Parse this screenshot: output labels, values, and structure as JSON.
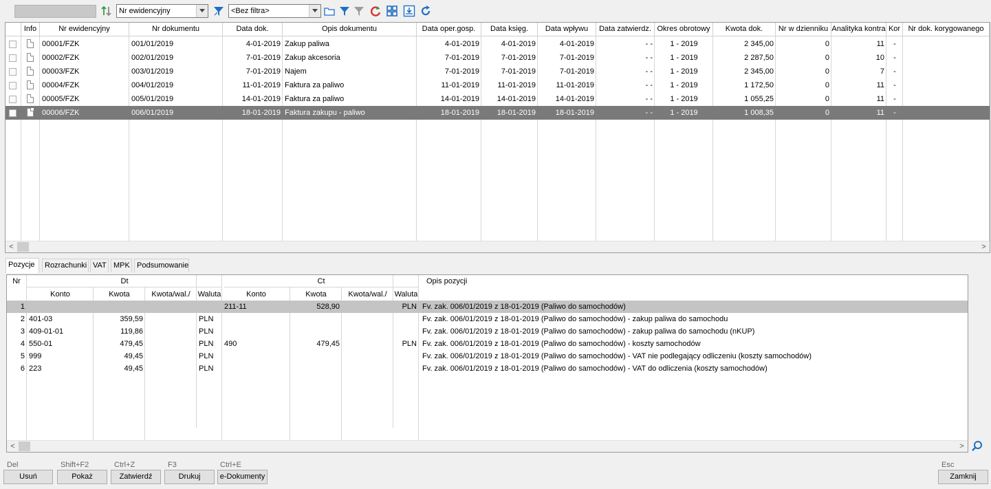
{
  "toolbar": {
    "sort_field": "Nr ewidencyjny",
    "filter_value": "<Bez filtra>",
    "icons": [
      "sort-arrows-icon",
      "filter-clear-icon",
      "folder-icon",
      "filter-icon",
      "filter-off-icon",
      "refresh-icon",
      "grid-icon",
      "export-icon",
      "reload-icon"
    ]
  },
  "grid": {
    "columns": [
      "Info",
      "Nr ewidencyjny",
      "Nr dokumentu",
      "Data dok.",
      "Opis dokumentu",
      "Data oper.gosp.",
      "Data księg.",
      "Data wpływu",
      "Data zatwierdz.",
      "Okres obrotowy",
      "Kwota dok.",
      "Nr w dzienniku",
      "Analityka kontra",
      "Kor",
      "Nr dok. korygowanego"
    ],
    "rows": [
      {
        "nr_ew": "00001/FZK",
        "nr_dok": "001/01/2019",
        "data_dok": "4-01-2019",
        "opis": "Zakup paliwa",
        "data_oper": "4-01-2019",
        "data_ksieg": "4-01-2019",
        "data_wpl": "4-01-2019",
        "data_zatw": "- -",
        "okres": "1 - 2019",
        "kwota": "2 345,00",
        "nr_dz": "0",
        "analityka": "11",
        "kor": "-"
      },
      {
        "nr_ew": "00002/FZK",
        "nr_dok": "002/01/2019",
        "data_dok": "7-01-2019",
        "opis": "Zakup akcesoria",
        "data_oper": "7-01-2019",
        "data_ksieg": "7-01-2019",
        "data_wpl": "7-01-2019",
        "data_zatw": "- -",
        "okres": "1 - 2019",
        "kwota": "2 287,50",
        "nr_dz": "0",
        "analityka": "10",
        "kor": "-"
      },
      {
        "nr_ew": "00003/FZK",
        "nr_dok": "003/01/2019",
        "data_dok": "7-01-2019",
        "opis": "Najem",
        "data_oper": "7-01-2019",
        "data_ksieg": "7-01-2019",
        "data_wpl": "7-01-2019",
        "data_zatw": "- -",
        "okres": "1 - 2019",
        "kwota": "2 345,00",
        "nr_dz": "0",
        "analityka": "7",
        "kor": "-"
      },
      {
        "nr_ew": "00004/FZK",
        "nr_dok": "004/01/2019",
        "data_dok": "11-01-2019",
        "opis": "Faktura za paliwo",
        "data_oper": "11-01-2019",
        "data_ksieg": "11-01-2019",
        "data_wpl": "11-01-2019",
        "data_zatw": "- -",
        "okres": "1 - 2019",
        "kwota": "1 172,50",
        "nr_dz": "0",
        "analityka": "11",
        "kor": "-"
      },
      {
        "nr_ew": "00005/FZK",
        "nr_dok": "005/01/2019",
        "data_dok": "14-01-2019",
        "opis": "Faktura za paliwo",
        "data_oper": "14-01-2019",
        "data_ksieg": "14-01-2019",
        "data_wpl": "14-01-2019",
        "data_zatw": "- -",
        "okres": "1 - 2019",
        "kwota": "1 055,25",
        "nr_dz": "0",
        "analityka": "11",
        "kor": "-"
      },
      {
        "nr_ew": "00006/FZK",
        "nr_dok": "006/01/2019",
        "data_dok": "18-01-2019",
        "opis": "Faktura zakupu - paliwo",
        "data_oper": "18-01-2019",
        "data_ksieg": "18-01-2019",
        "data_wpl": "18-01-2019",
        "data_zatw": "- -",
        "okres": "1 - 2019",
        "kwota": "1 008,35",
        "nr_dz": "0",
        "analityka": "11",
        "kor": "-"
      }
    ],
    "selected_row": 6
  },
  "tabs": [
    "Pozycje",
    "Rozrachunki",
    "VAT",
    "MPK",
    "Podsumowanie"
  ],
  "active_tab": "Pozycje",
  "positions": {
    "headers": {
      "nr": "Nr",
      "dt": "Dt",
      "ct": "Ct",
      "opis": "Opis pozycji",
      "konto": "Konto",
      "kwota": "Kwota",
      "kwota_wal": "Kwota/wal./",
      "waluta": "Waluta"
    },
    "rows": [
      {
        "nr": "1",
        "dt_konto": "",
        "dt_kwota": "",
        "dt_kwota_wal": "",
        "dt_waluta": "",
        "ct_konto": "211-11",
        "ct_kwota": "528,90",
        "ct_kwota_wal": "",
        "ct_waluta": "PLN",
        "opis": "Fv. zak. 006/01/2019 z 18-01-2019 (Paliwo do samochodów)"
      },
      {
        "nr": "2",
        "dt_konto": "401-03",
        "dt_kwota": "359,59",
        "dt_kwota_wal": "",
        "dt_waluta": "PLN",
        "ct_konto": "",
        "ct_kwota": "",
        "ct_kwota_wal": "",
        "ct_waluta": "",
        "opis": "Fv. zak. 006/01/2019 z 18-01-2019 (Paliwo do samochodów) - zakup paliwa do samochodu"
      },
      {
        "nr": "3",
        "dt_konto": "409-01-01",
        "dt_kwota": "119,86",
        "dt_kwota_wal": "",
        "dt_waluta": "PLN",
        "ct_konto": "",
        "ct_kwota": "",
        "ct_kwota_wal": "",
        "ct_waluta": "",
        "opis": "Fv. zak. 006/01/2019 z 18-01-2019 (Paliwo do samochodów) - zakup paliwa do samochodu (nKUP)"
      },
      {
        "nr": "4",
        "dt_konto": "550-01",
        "dt_kwota": "479,45",
        "dt_kwota_wal": "",
        "dt_waluta": "PLN",
        "ct_konto": "490",
        "ct_kwota": "479,45",
        "ct_kwota_wal": "",
        "ct_waluta": "PLN",
        "opis": "Fv. zak. 006/01/2019 z 18-01-2019 (Paliwo do samochodów) - koszty samochodów"
      },
      {
        "nr": "5",
        "dt_konto": "999",
        "dt_kwota": "49,45",
        "dt_kwota_wal": "",
        "dt_waluta": "PLN",
        "ct_konto": "",
        "ct_kwota": "",
        "ct_kwota_wal": "",
        "ct_waluta": "",
        "opis": "Fv. zak. 006/01/2019 z 18-01-2019 (Paliwo do samochodów) - VAT nie podlegający odliczeniu (koszty samochodów)"
      },
      {
        "nr": "6",
        "dt_konto": "223",
        "dt_kwota": "49,45",
        "dt_kwota_wal": "",
        "dt_waluta": "PLN",
        "ct_konto": "",
        "ct_kwota": "",
        "ct_kwota_wal": "",
        "ct_waluta": "",
        "opis": "Fv. zak. 006/01/2019 z 18-01-2019 (Paliwo do samochodów) - VAT do odliczenia (koszty samochodów)"
      }
    ]
  },
  "buttons": {
    "usun": {
      "key": "Del",
      "label": "Usuń"
    },
    "pokaz": {
      "key": "Shift+F2",
      "label": "Pokaż"
    },
    "zatwierdz": {
      "key": "Ctrl+Z",
      "label": "Zatwierdź"
    },
    "drukuj": {
      "key": "F3",
      "label": "Drukuj"
    },
    "edok": {
      "key": "Ctrl+E",
      "label": "e-Dokumenty"
    },
    "zamknij": {
      "key": "Esc",
      "label": "Zamknij"
    }
  },
  "colors": {
    "selected_row": "#7a7a7a",
    "selected_position": "#c4c4c4",
    "accent_blue": "#1e6fc4",
    "accent_red": "#d9302b",
    "accent_green": "#2e9e45"
  }
}
